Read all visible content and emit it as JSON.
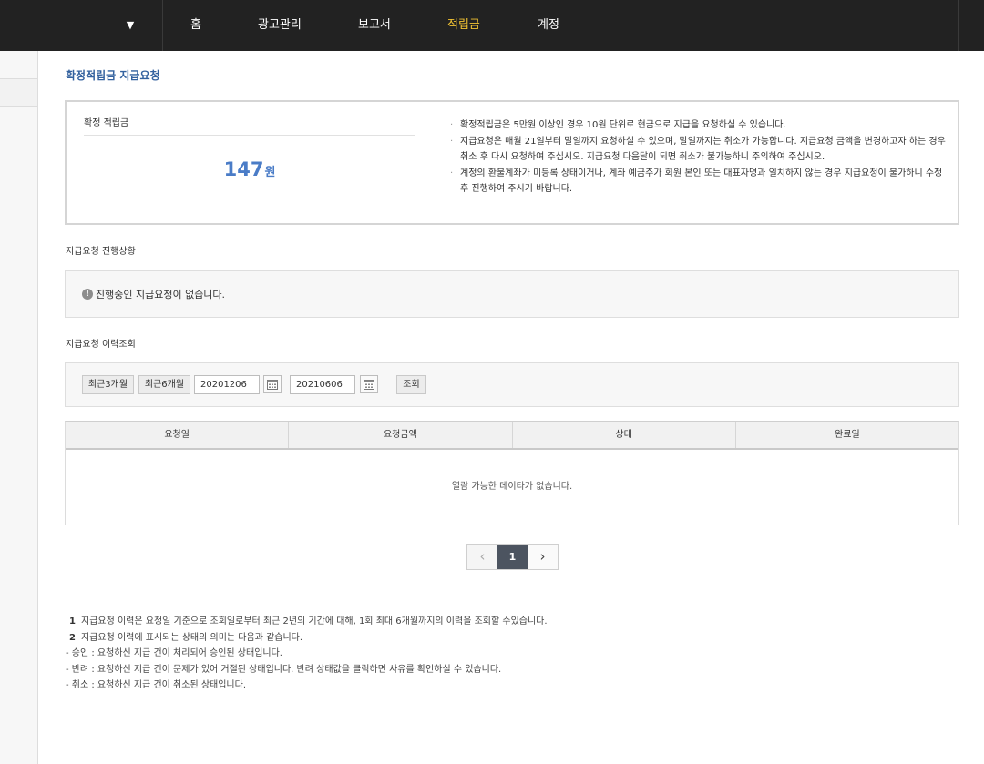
{
  "nav": {
    "items": [
      {
        "label": "홈",
        "active": false
      },
      {
        "label": "광고관리",
        "active": false
      },
      {
        "label": "보고서",
        "active": false
      },
      {
        "label": "적립금",
        "active": true
      },
      {
        "label": "계정",
        "active": false
      }
    ],
    "dropdown_icon": "▼"
  },
  "page": {
    "title": "확정적립금 지급요청"
  },
  "summary": {
    "label": "확정 적립금",
    "amount": "147",
    "unit": "원",
    "notes": [
      "확정적립금은 5만원 이상인 경우 10원 단위로 현금으로 지급을 요청하실 수 있습니다.",
      "지급요청은 매월 21일부터 말일까지 요청하실 수 있으며, 말일까지는 취소가 가능합니다. 지급요청 금액을 변경하고자 하는 경우 취소 후 다시 요청하여 주십시오. 지급요청 다음달이 되면 취소가 불가능하니 주의하여 주십시오.",
      "계정의 환불계좌가 미등록 상태이거나, 계좌 예금주가 회원 본인 또는 대표자명과 일치하지 않는 경우 지급요청이 불가하니 수정 후 진행하여 주시기 바랍니다."
    ]
  },
  "progress": {
    "title": "지급요청 진행상황",
    "message": "진행중인 지급요청이 없습니다."
  },
  "history": {
    "title": "지급요청 이력조회",
    "btn_3months": "최근3개월",
    "btn_6months": "최근6개월",
    "start_date": "20201206",
    "end_date": "20210606",
    "search_label": "조회",
    "columns": [
      "요청일",
      "요청금액",
      "상태",
      "완료일"
    ],
    "empty_message": "열람 가능한 데이타가 없습니다."
  },
  "pagination": {
    "prev": "‹",
    "current": "1",
    "next": "›"
  },
  "footnotes": [
    {
      "num": "1",
      "text": "지급요청 이력은 요청일 기준으로 조회일로부터 최근 2년의 기간에 대해, 1회 최대 6개월까지의 이력을 조회할 수있습니다."
    },
    {
      "num": "2",
      "text": "지급요청 이력에 표시되는 상태의 의미는 다음과 같습니다."
    },
    {
      "num": "",
      "text": "- 승인 : 요청하신 지급 건이 처리되어 승인된 상태입니다."
    },
    {
      "num": "",
      "text": "- 반려 : 요청하신 지급 건이 문제가 있어 거절된 상태입니다. 반려 상태값을 클릭하면 사유를 확인하실 수 있습니다."
    },
    {
      "num": "",
      "text": "- 취소 : 요청하신 지급 건이 취소된 상태입니다."
    }
  ],
  "colors": {
    "topbar": "#222222",
    "active_nav": "#f1c232",
    "title_blue": "#34629f",
    "amount_blue": "#4a7cc7",
    "pager_current": "#4c5460"
  },
  "icons": {
    "info": "info-circle-icon",
    "calendar": "calendar-icon",
    "dropdown": "chevron-down-icon"
  }
}
